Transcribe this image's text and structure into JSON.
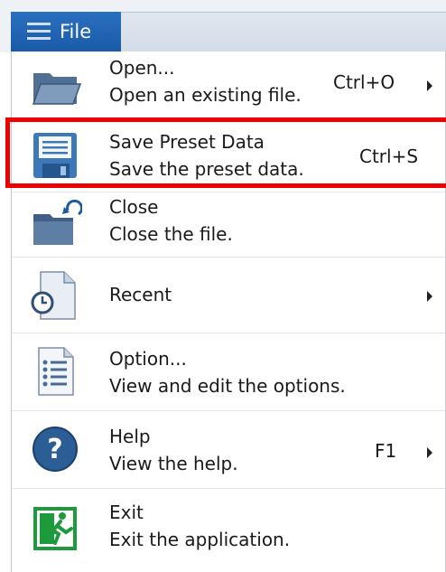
{
  "menubar": {
    "file_label": "File"
  },
  "menu": {
    "items": [
      {
        "title": "Open...",
        "desc": "Open an existing file.",
        "shortcut": "Ctrl+O",
        "submenu": true,
        "icon": "folder-open-icon"
      },
      {
        "title": "Save Preset Data",
        "desc": "Save the preset data.",
        "shortcut": "Ctrl+S",
        "submenu": false,
        "icon": "floppy-disk-icon"
      },
      {
        "title": "Close",
        "desc": "Close the file.",
        "shortcut": "",
        "submenu": false,
        "icon": "folder-close-icon"
      },
      {
        "title": "Recent",
        "desc": "",
        "shortcut": "",
        "submenu": true,
        "icon": "recent-document-icon"
      },
      {
        "title": "Option...",
        "desc": "View and edit the options.",
        "shortcut": "",
        "submenu": false,
        "icon": "options-list-icon"
      },
      {
        "title": "Help",
        "desc": "View the help.",
        "shortcut": "F1",
        "submenu": true,
        "icon": "help-icon"
      },
      {
        "title": "Exit",
        "desc": "Exit the application.",
        "shortcut": "",
        "submenu": false,
        "icon": "exit-icon"
      }
    ]
  },
  "colors": {
    "file_tab": "#1a5aa8",
    "highlight": "#ee0000"
  }
}
